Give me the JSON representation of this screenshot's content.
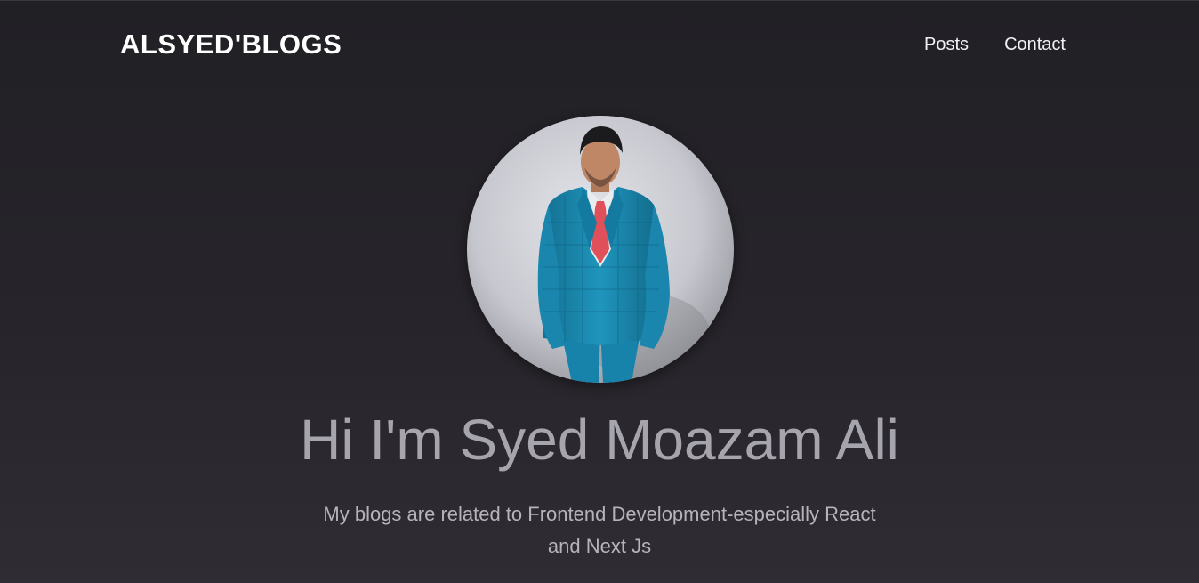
{
  "header": {
    "brand": "ALSYED'BLOGS",
    "nav": [
      {
        "label": "Posts"
      },
      {
        "label": "Contact"
      }
    ]
  },
  "hero": {
    "avatar_icon": "profile-photo",
    "title": "Hi I'm Syed Moazam Ali",
    "subtitle": "My blogs are related to Frontend Development-especially React and Next Js"
  },
  "colors": {
    "background": "#26242a",
    "title": "#a6a4ac",
    "subtitle": "#b6b4bb",
    "nav_text": "#f2f2f4",
    "suit": "#1e8fb6",
    "tie": "#e0505a"
  }
}
